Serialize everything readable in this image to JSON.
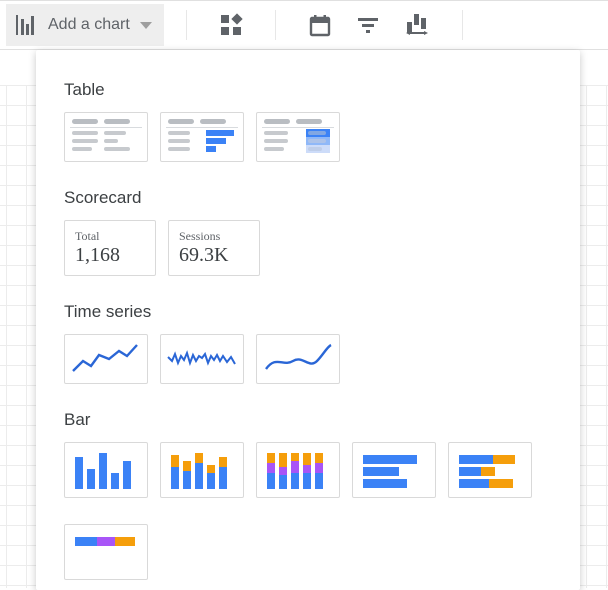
{
  "toolbar": {
    "addChartLabel": "Add a chart"
  },
  "panel": {
    "sections": {
      "table": "Table",
      "scorecard": "Scorecard",
      "timeseries": "Time series",
      "bar": "Bar"
    },
    "scorecards": [
      {
        "label": "Total",
        "value": "1,168"
      },
      {
        "label": "Sessions",
        "value": "69.3K"
      }
    ]
  }
}
